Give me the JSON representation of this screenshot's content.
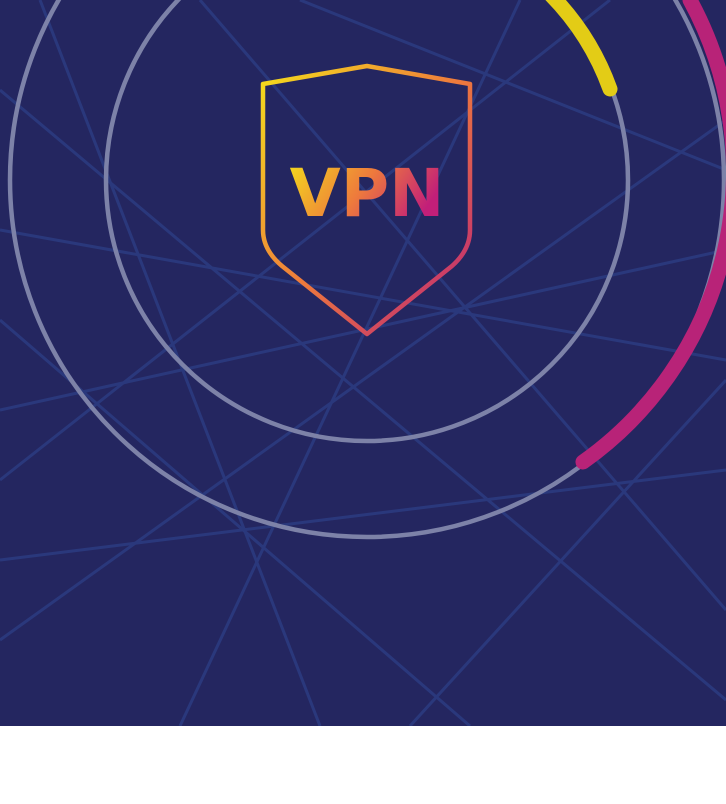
{
  "hero": {
    "logo_text": "VPN",
    "colors": {
      "background": "#242660",
      "ring": "#7d82a8",
      "arc_yellow": "#e3cc16",
      "arc_magenta": "#b82378",
      "gradient_start": "#f4de1b",
      "gradient_mid": "#ee7a3c",
      "gradient_end": "#c21f79",
      "web_lines": "#2d3f86"
    }
  }
}
